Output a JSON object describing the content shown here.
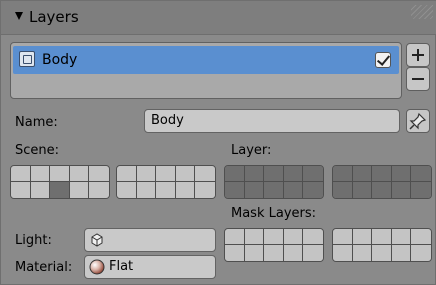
{
  "panel": {
    "title": "Layers"
  },
  "layers_list": {
    "items": [
      {
        "label": "Body",
        "checked": true,
        "selected": true
      }
    ],
    "add_icon": "plus-icon",
    "remove_icon": "minus-icon"
  },
  "name_field": {
    "label": "Name:",
    "value": "Body",
    "pin_icon": "pin-icon"
  },
  "scene": {
    "label": "Scene:",
    "groups": [
      {
        "cells": [
          false,
          false,
          false,
          false,
          false,
          false,
          false,
          true,
          false,
          false
        ]
      },
      {
        "cells": [
          false,
          false,
          false,
          false,
          false,
          false,
          false,
          false,
          false,
          false
        ]
      }
    ]
  },
  "layer": {
    "label": "Layer:",
    "groups": [
      {
        "cells": [
          true,
          true,
          true,
          true,
          true,
          true,
          true,
          true,
          true,
          true
        ]
      },
      {
        "cells": [
          true,
          true,
          true,
          true,
          true,
          true,
          true,
          true,
          true,
          true
        ]
      }
    ]
  },
  "mask_layers": {
    "label": "Mask Layers:",
    "groups": [
      {
        "cells": [
          false,
          false,
          false,
          false,
          false,
          false,
          false,
          false,
          false,
          false
        ]
      },
      {
        "cells": [
          false,
          false,
          false,
          false,
          false,
          false,
          false,
          false,
          false,
          false
        ]
      }
    ]
  },
  "light": {
    "label": "Light:",
    "value": "",
    "icon": "lamp-icon"
  },
  "material": {
    "label": "Material:",
    "value": "Flat",
    "icon": "material-sphere-icon"
  },
  "colors": {
    "selected_row": "#5a8fd0",
    "panel_bg": "#8a8a8a",
    "field_bg": "#c9c9c9"
  }
}
